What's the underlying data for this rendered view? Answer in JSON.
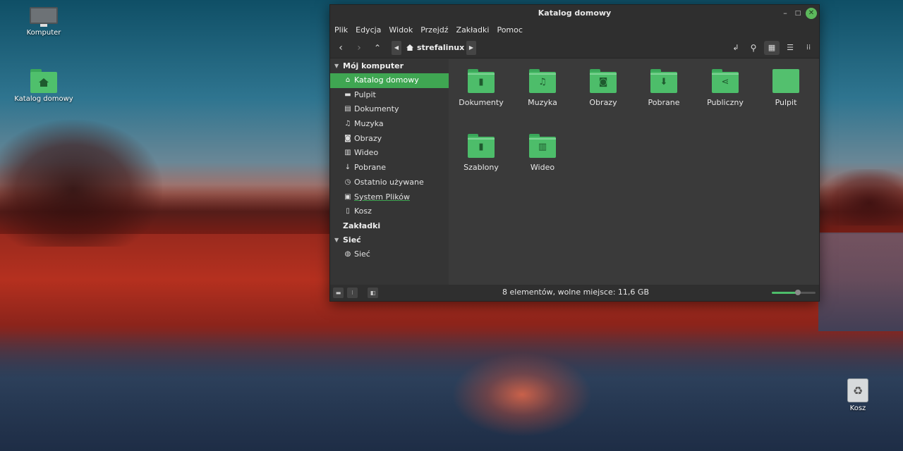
{
  "desktop": {
    "icons": [
      {
        "label": "Komputer",
        "icon": "computer-icon"
      },
      {
        "label": "Katalog domowy",
        "icon": "home-folder-icon"
      },
      {
        "label": "Kosz",
        "icon": "trash-icon"
      }
    ]
  },
  "window": {
    "title": "Katalog domowy",
    "menu": [
      "Plik",
      "Edycja",
      "Widok",
      "Przejdź",
      "Zakładki",
      "Pomoc"
    ],
    "breadcrumb": "strefalinux"
  },
  "sidebar": {
    "sections": [
      {
        "label": "Mój komputer"
      },
      {
        "label": "Zakładki"
      },
      {
        "label": "Sieć"
      }
    ],
    "items": [
      {
        "label": "Katalog domowy",
        "icon": "home-icon",
        "selected": true
      },
      {
        "label": "Pulpit",
        "icon": "desktop-icon"
      },
      {
        "label": "Dokumenty",
        "icon": "document-icon"
      },
      {
        "label": "Muzyka",
        "icon": "music-icon"
      },
      {
        "label": "Obrazy",
        "icon": "camera-icon"
      },
      {
        "label": "Wideo",
        "icon": "film-icon"
      },
      {
        "label": "Pobrane",
        "icon": "download-icon"
      },
      {
        "label": "Ostatnio używane",
        "icon": "clock-icon"
      },
      {
        "label": "System Plików",
        "icon": "drive-icon"
      },
      {
        "label": "Kosz",
        "icon": "trash-icon"
      },
      {
        "label": "Sieć",
        "icon": "globe-icon"
      }
    ]
  },
  "files": [
    {
      "name": "Dokumenty",
      "icon": "document-icon"
    },
    {
      "name": "Muzyka",
      "icon": "music-icon"
    },
    {
      "name": "Obrazy",
      "icon": "camera-icon"
    },
    {
      "name": "Pobrane",
      "icon": "download-icon"
    },
    {
      "name": "Publiczny",
      "icon": "share-icon"
    },
    {
      "name": "Pulpit",
      "icon": "desktop-folder-icon"
    },
    {
      "name": "Szablony",
      "icon": "template-icon"
    },
    {
      "name": "Wideo",
      "icon": "film-icon"
    }
  ],
  "status": {
    "text": "8 elementów, wolne miejsce: 11,6 GB",
    "zoom_fraction": 0.6
  },
  "colors": {
    "accent": "#3fa652",
    "folder": "#4dbd6a"
  }
}
